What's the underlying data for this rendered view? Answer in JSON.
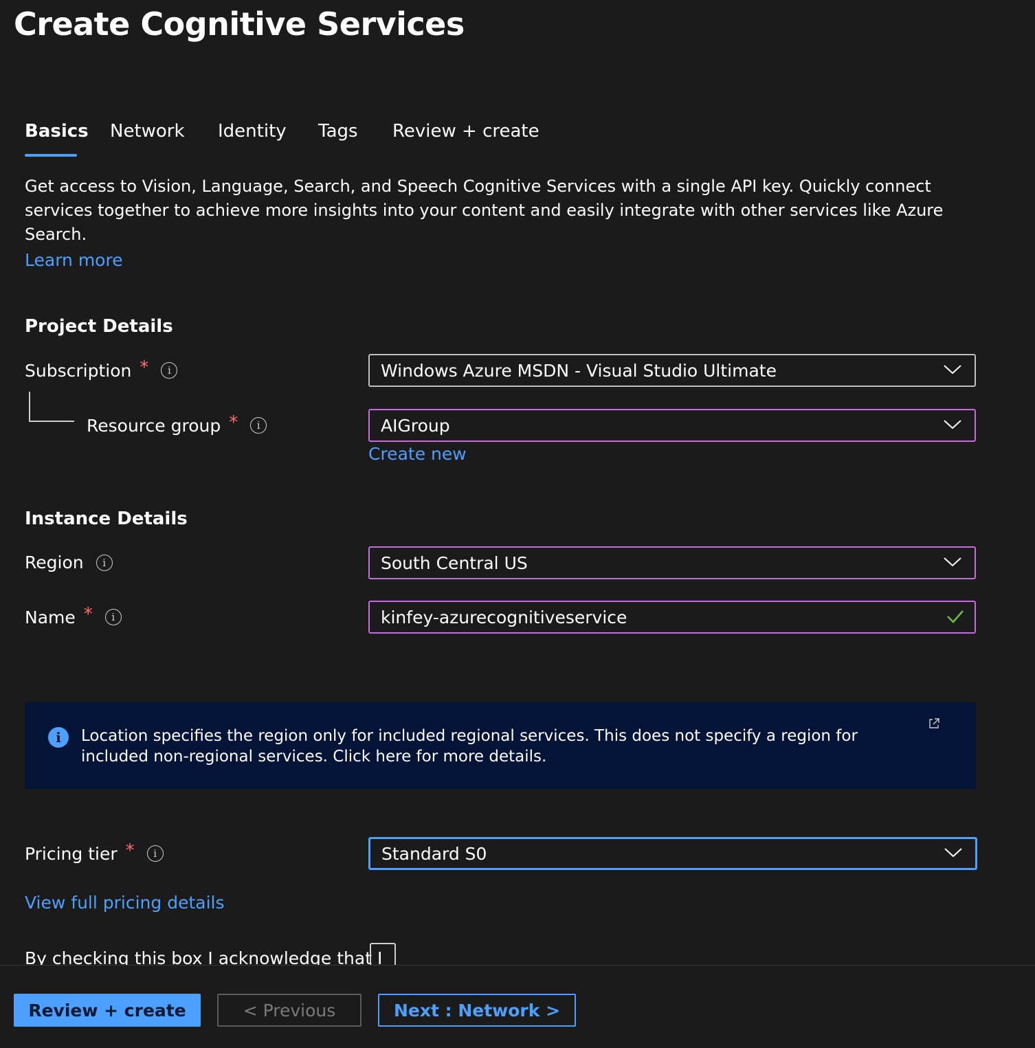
{
  "page": {
    "title": "Create Cognitive Services",
    "more": "···"
  },
  "tabs": [
    {
      "label": "Basics",
      "active": true
    },
    {
      "label": "Network",
      "active": false
    },
    {
      "label": "Identity",
      "active": false
    },
    {
      "label": "Tags",
      "active": false
    },
    {
      "label": "Review + create",
      "active": false
    }
  ],
  "description": "Get access to Vision, Language, Search, and Speech Cognitive Services with a single API key. Quickly connect services together to achieve more insights into your content and easily integrate with other services like Azure Search.",
  "learn_more": "Learn more",
  "project_details": {
    "heading": "Project Details",
    "subscription": {
      "label": "Subscription",
      "required": "*",
      "value": "Windows Azure MSDN - Visual Studio Ultimate"
    },
    "resource_group": {
      "label": "Resource group",
      "required": "*",
      "value": "AIGroup",
      "create_new": "Create new"
    }
  },
  "instance_details": {
    "heading": "Instance Details",
    "region": {
      "label": "Region",
      "value": "South Central US"
    },
    "name": {
      "label": "Name",
      "required": "*",
      "value": "kinfey-azurecognitiveservice"
    }
  },
  "info_banner": {
    "icon": "i",
    "text": "Location specifies the region only for included regional services. This does not specify a region for included non-regional services. Click here for more details."
  },
  "pricing": {
    "label": "Pricing tier",
    "required": "*",
    "value": "Standard S0",
    "details_link": "View full pricing details"
  },
  "acknowledge": {
    "text": "By checking this box I acknowledge that I"
  },
  "footer": {
    "review_create": "Review + create",
    "previous": "< Previous",
    "next": "Next : Network >"
  },
  "colors": {
    "background": "#1b1b1b",
    "accent": "#4da0ff",
    "focus_border": "#c56de0",
    "required": "#ff6b6b",
    "banner": "#041437",
    "valid": "#6cc24a"
  },
  "icons": {
    "info": "info-icon",
    "chevron": "chevron-down-icon",
    "valid": "checkmark-icon",
    "external": "external-link-icon"
  }
}
